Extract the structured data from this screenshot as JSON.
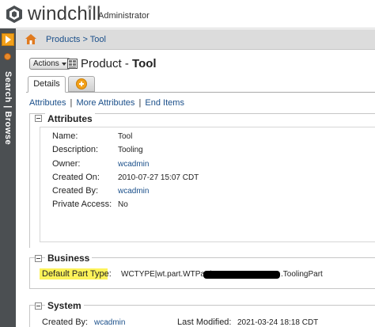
{
  "header": {
    "brand": "windchill",
    "trademark": "®",
    "role": "Administrator",
    "logo_icon": "windchill-logo-icon"
  },
  "navigator": {
    "label": "Search | Browse",
    "toggle_icon": "expand-arrow-icon",
    "colors": {
      "background": "#4b4f52",
      "accent": "#f2a019"
    }
  },
  "breadcrumb": {
    "home_icon": "home-icon",
    "text": "Products > Tool"
  },
  "titlebar": {
    "actions_label": "Actions",
    "type_prefix": "Product - ",
    "name": "Tool"
  },
  "tabs": [
    {
      "label": "Details",
      "active": true
    },
    {
      "label": "",
      "icon": "add-tab-icon",
      "active": false
    }
  ],
  "sublinks": [
    "Attributes",
    "More Attributes",
    "End Items"
  ],
  "sublink_separator": "|",
  "attributes": {
    "title": "Attributes",
    "rows": [
      {
        "label": "Name:",
        "value": "Tool"
      },
      {
        "label": "Description:",
        "value": "Tooling"
      },
      {
        "label": "Owner:",
        "value": "wcadmin"
      },
      {
        "label": "Created On:",
        "value": "2010-07-27 15:07 CDT"
      },
      {
        "label": "Created By:",
        "value": "wcadmin"
      },
      {
        "label": "Private Access:",
        "value": "No"
      }
    ]
  },
  "business": {
    "title": "Business",
    "label": "Default Part Type:",
    "value_prefix": "WCTYPE|wt.part.WTPart|",
    "value_suffix": ".ToolingPart",
    "highlight_color": "#fdf35a"
  },
  "system": {
    "title": "System",
    "created_by_label": "Created By:",
    "created_by_value": "wcadmin",
    "modified_label": "Last Modified:",
    "modified_value": "2021-03-24 18:18 CDT"
  }
}
